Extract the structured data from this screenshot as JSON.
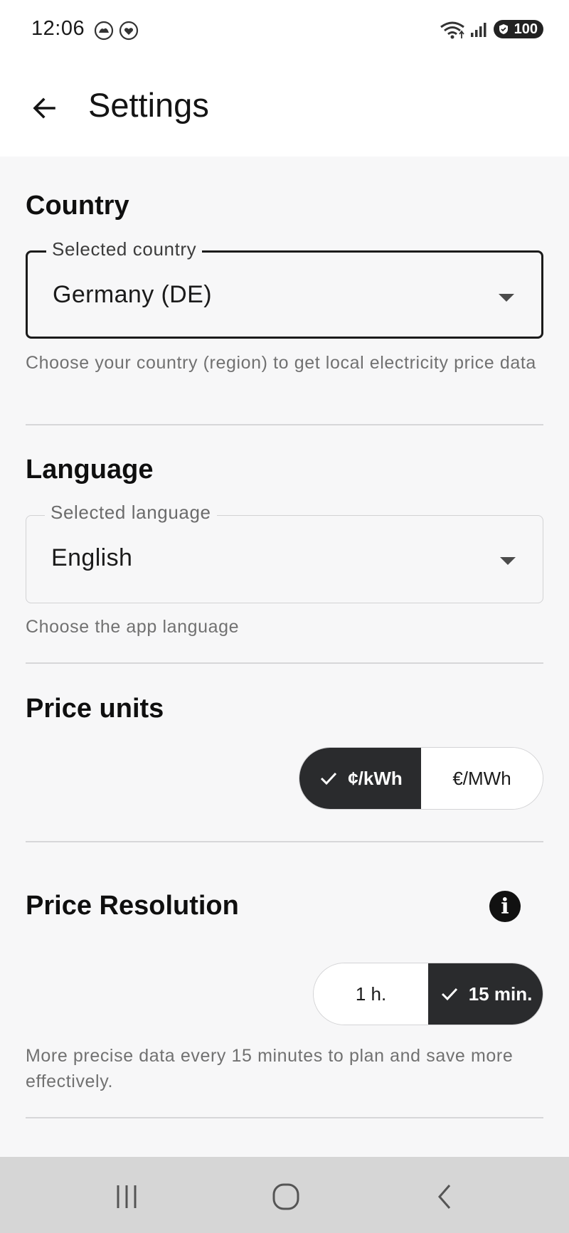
{
  "status_bar": {
    "time": "12:06",
    "left_icons": [
      "weather-icon",
      "heart-notification-icon"
    ],
    "right_icons": [
      "wifi-icon",
      "signal-icon"
    ],
    "battery": "100"
  },
  "app_bar": {
    "back_icon": "arrow-left-icon",
    "title": "Settings"
  },
  "country": {
    "title": "Country",
    "field_label": "Selected country",
    "value": "Germany (DE)",
    "helper": "Choose your country (region) to get local electricity price data"
  },
  "language": {
    "title": "Language",
    "field_label": "Selected language",
    "value": "English",
    "helper": "Choose the app language"
  },
  "price_units": {
    "title": "Price units",
    "options": [
      {
        "label": "¢/kWh",
        "selected": true
      },
      {
        "label": "€/MWh",
        "selected": false
      }
    ]
  },
  "price_resolution": {
    "title": "Price Resolution",
    "info_icon": "info-icon",
    "options": [
      {
        "label": "1 h.",
        "selected": false
      },
      {
        "label": "15 min.",
        "selected": true
      }
    ],
    "helper": "More precise data every 15 minutes to plan and save more effectively."
  },
  "nav_bar": {
    "buttons": [
      "recent-apps-icon",
      "home-icon",
      "back-icon"
    ]
  },
  "colors": {
    "background": "#f7f7f8",
    "selected_segment": "#2a2b2d",
    "divider": "#d7d7d9",
    "nav_bar": "#d6d6d6"
  }
}
